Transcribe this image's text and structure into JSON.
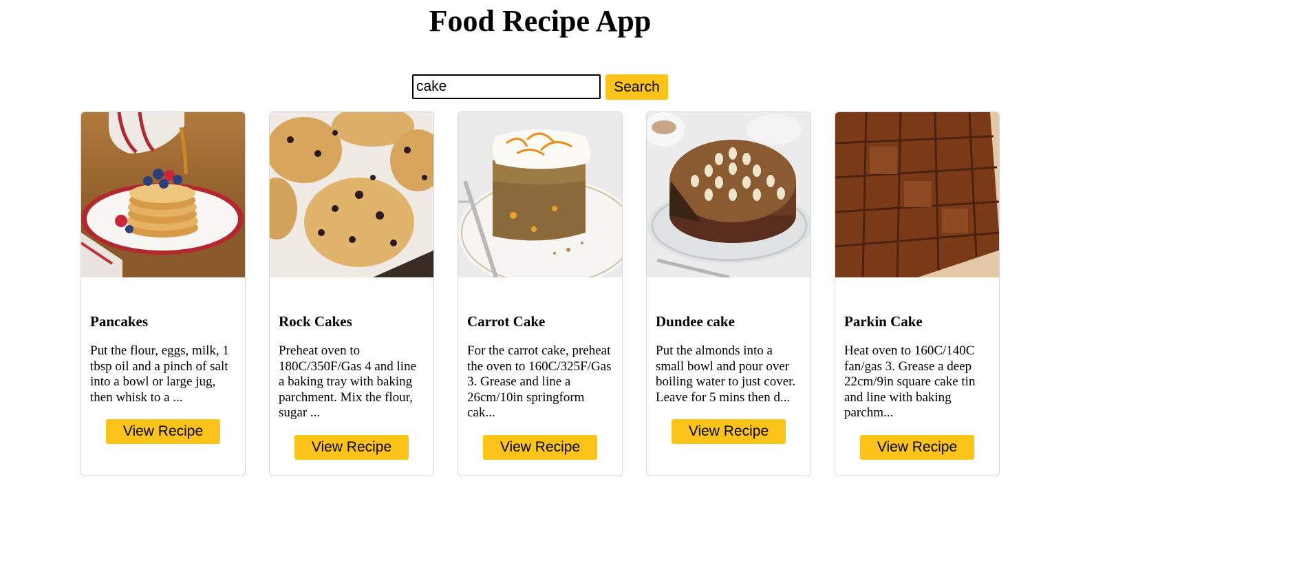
{
  "header": {
    "title": "Food Recipe App"
  },
  "search": {
    "value": "cake",
    "button_label": "Search"
  },
  "theme": {
    "accent": "#fcc419",
    "card_border": "#d6d6d6"
  },
  "recipes": [
    {
      "title": "Pancakes",
      "description": "Put the flour, eggs, milk, 1 tbsp oil and a pinch of salt into a bowl or large jug, then whisk to a ...",
      "button_label": "View Recipe"
    },
    {
      "title": "Rock Cakes",
      "description": "Preheat oven to 180C/350F/Gas 4 and line a baking tray with baking parchment. Mix the flour, sugar ...",
      "button_label": "View Recipe"
    },
    {
      "title": "Carrot Cake",
      "description": "For the carrot cake, preheat the oven to 160C/325F/Gas 3. Grease and line a 26cm/10in springform cak...",
      "button_label": "View Recipe"
    },
    {
      "title": "Dundee cake",
      "description": "Put the almonds into a small bowl and pour over boiling water to just cover. Leave for 5 mins then d...",
      "button_label": "View Recipe"
    },
    {
      "title": "Parkin Cake",
      "description": "Heat oven to 160C/140C fan/gas 3. Grease a deep 22cm/9in square cake tin and line with baking parchm...",
      "button_label": "View Recipe"
    }
  ]
}
